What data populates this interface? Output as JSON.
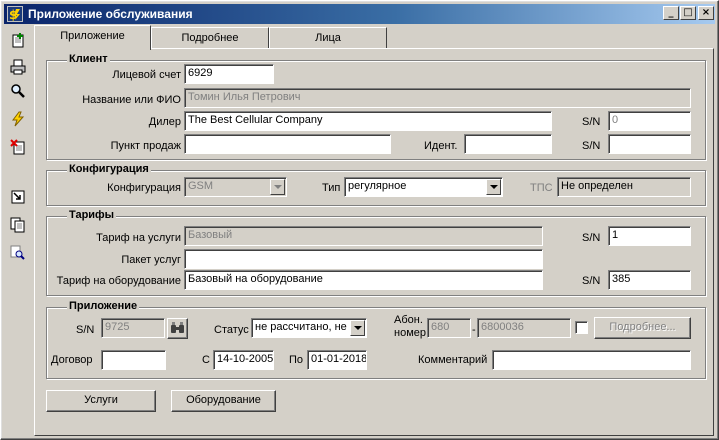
{
  "window": {
    "title": "Приложение обслуживания",
    "controls": {
      "minimize": "_",
      "maximize": "□",
      "close": "×"
    }
  },
  "toolbar": {
    "icons": [
      "add-document-icon",
      "print-icon",
      "search-icon",
      "lightning-icon",
      "delete-document-icon",
      "jump-icon",
      "copy-documents-icon",
      "search-documents-icon"
    ]
  },
  "tabs": [
    {
      "label": "Приложение",
      "active": true
    },
    {
      "label": "Подробнее",
      "active": false
    },
    {
      "label": "Лица",
      "active": false
    }
  ],
  "client": {
    "title": "Клиент",
    "account_label": "Лицевой счет",
    "account_value": "6929",
    "name_label": "Название или ФИО",
    "name_value": "Томин Илья Петрович",
    "dealer_label": "Дилер",
    "dealer_value": "The Best Cellular Company",
    "dealer_sn_label": "S/N",
    "dealer_sn_value": "0",
    "point_label": "Пункт продаж",
    "point_value": "",
    "ident_label": "Идент.",
    "ident_value": "",
    "point_sn_label": "S/N",
    "point_sn_value": ""
  },
  "configuration": {
    "title": "Конфигурация",
    "config_label": "Конфигурация",
    "config_value": "GSM",
    "type_label": "Тип",
    "type_value": "регулярное",
    "tps_label": "ТПС",
    "tps_value": "Не определен"
  },
  "tariffs": {
    "title": "Тарифы",
    "service_label": "Тариф на услуги",
    "service_value": "Базовый",
    "service_sn_label": "S/N",
    "service_sn_value": "1",
    "package_label": "Пакет услуг",
    "package_value": "",
    "equipment_label": "Тариф на оборудование",
    "equipment_value": "Базовый на оборудование",
    "equipment_sn_label": "S/N",
    "equipment_sn_value": "385"
  },
  "application": {
    "title": "Приложение",
    "sn_label": "S/N",
    "sn_value": "9725",
    "status_label": "Статус",
    "status_value": "не рассчитано, не",
    "abon_label_line1": "Абон.",
    "abon_label_line2": "номер",
    "abon_code": "680",
    "abon_separator": "-",
    "abon_number": "6800036",
    "details_button": "Подробнее...",
    "contract_label": "Договор",
    "contract_value": "",
    "from_label": "С",
    "from_value": "14-10-2005",
    "to_label": "По",
    "to_value": "01-01-2018",
    "comment_label": "Комментарий",
    "comment_value": ""
  },
  "buttons": {
    "services": "Услуги",
    "equipment": "Оборудование"
  }
}
